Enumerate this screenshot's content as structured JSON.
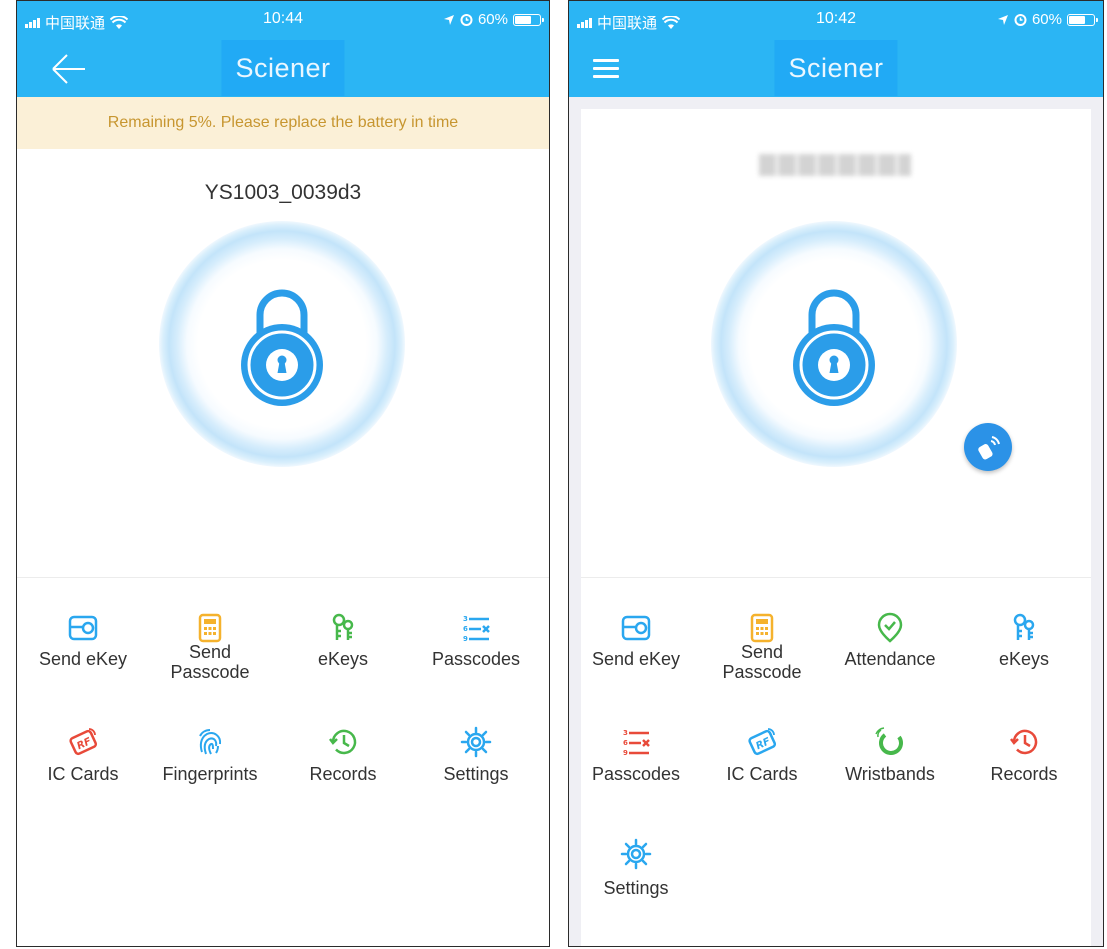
{
  "left_screen": {
    "status_bar": {
      "carrier": "中国联通",
      "time": "10:44",
      "battery": "60%"
    },
    "nav": {
      "title": "Sciener"
    },
    "warning": "Remaining 5%. Please replace the battery in time",
    "lock_name": "YS1003_0039d3",
    "grid": [
      {
        "label": "Send eKey",
        "icon": "send-ekey-icon",
        "color": "#2aa7ef"
      },
      {
        "label": "Send Passcode",
        "icon": "send-passcode-icon",
        "color": "#f5b22d"
      },
      {
        "label": "eKeys",
        "icon": "ekeys-icon",
        "color": "#47b84b"
      },
      {
        "label": "Passcodes",
        "icon": "passcodes-icon",
        "color": "#2aa7ef"
      },
      {
        "label": "IC Cards",
        "icon": "ic-card-icon",
        "color": "#e84a3a"
      },
      {
        "label": "Fingerprints",
        "icon": "fingerprint-icon",
        "color": "#2aa7ef"
      },
      {
        "label": "Records",
        "icon": "records-icon",
        "color": "#47b84b"
      },
      {
        "label": "Settings",
        "icon": "settings-icon",
        "color": "#2aa7ef"
      }
    ]
  },
  "right_screen": {
    "status_bar": {
      "carrier": "中国联通",
      "time": "10:42",
      "battery": "60%"
    },
    "nav": {
      "title": "Sciener"
    },
    "grid": [
      {
        "label": "Send eKey",
        "icon": "send-ekey-icon",
        "color": "#2aa7ef"
      },
      {
        "label": "Send Passcode",
        "icon": "send-passcode-icon",
        "color": "#f5b22d"
      },
      {
        "label": "Attendance",
        "icon": "attendance-icon",
        "color": "#47b84b"
      },
      {
        "label": "eKeys",
        "icon": "ekeys-icon",
        "color": "#2aa7ef"
      },
      {
        "label": "Passcodes",
        "icon": "passcodes-icon",
        "color": "#e84a3a"
      },
      {
        "label": "IC Cards",
        "icon": "ic-card-icon",
        "color": "#2aa7ef"
      },
      {
        "label": "Wristbands",
        "icon": "wristband-icon",
        "color": "#47b84b"
      },
      {
        "label": "Records",
        "icon": "records-icon",
        "color": "#e84a3a"
      },
      {
        "label": "Settings",
        "icon": "settings-icon",
        "color": "#2aa7ef"
      }
    ]
  },
  "colors": {
    "brand_blue": "#2bb5f4",
    "lock_blue": "#2b9de9",
    "warning_text": "#c79630"
  }
}
